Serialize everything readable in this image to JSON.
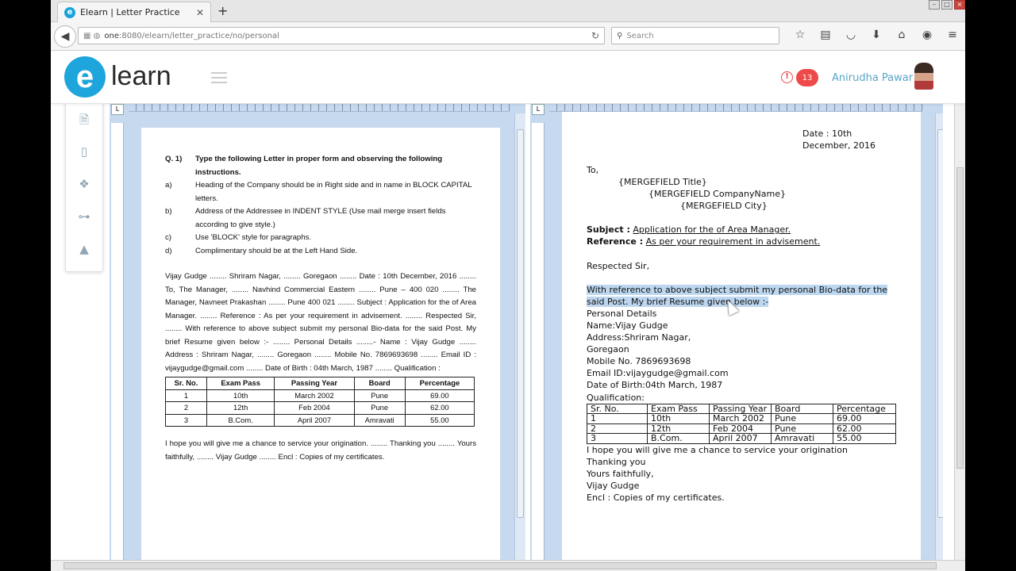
{
  "browser": {
    "tab_title": "Elearn | Letter Practice",
    "tab_favicon": "e",
    "url_host": "one",
    "url_path": ":8080/elearn/letter_practice/no/personal",
    "search_placeholder": "Search",
    "new_tab_label": "+",
    "close_label": "✕"
  },
  "app": {
    "logo_mark": "e",
    "logo_text": "learn",
    "notification_count": "13",
    "alert_glyph": "!",
    "user_name": "Anirudha Pawar",
    "brand_color": "#1ea5dc",
    "badge_color": "#ee4a4a"
  },
  "sidebar_icons": [
    "document-icon",
    "file-icon",
    "dropbox-icon",
    "gamepad-icon",
    "graduation-cap-icon"
  ],
  "left_page": {
    "q_num": "Q. 1)",
    "q_title": "Type the following Letter in proper form and observing the following instructions.",
    "instructions": [
      {
        "marker": "a)",
        "text": "Heading of the Company should be in Right side and in name in BLOCK CAPITAL letters."
      },
      {
        "marker": "b)",
        "text": "Address of the Addressee in INDENT STYLE (Use mail merge insert fields according to give style.)"
      },
      {
        "marker": "c)",
        "text": "Use 'BLOCK' style for paragraphs."
      },
      {
        "marker": "d)",
        "text": "Complimentary should be at the Left Hand Side."
      }
    ],
    "body": "Vijay Gudge ........ Shriram Nagar, ........ Goregaon ........ Date : 10th December, 2016 ........ To, The Manager, ........ Navhind Commercial Eastern ........ Pune – 400 020 ........ The Manager, Navneet Prakashan ........ Pune 400 021 ........ Subject : Application for the of Area Manager. ........ Reference : As per your requirement in advisement. ........ Respected Sir, ........ With reference to above subject submit my personal Bio-data for the said Post. My brief Resume given below :- ........ Personal Details ........- Name : Vijay Gudge ........ Address : Shriram Nagar, ........ Goregaon ........ Mobile No. 7869693698 ........ Email ID : vijaygudge@gmail.com ........ Date of Birth : 04th March, 1987 ........ Qualification :",
    "table_headers": [
      "Sr. No.",
      "Exam Pass",
      "Passing Year",
      "Board",
      "Percentage"
    ],
    "table_rows": [
      [
        "1",
        "10th",
        "March 2002",
        "Pune",
        "69.00"
      ],
      [
        "2",
        "12th",
        "Feb 2004",
        "Pune",
        "62.00"
      ],
      [
        "3",
        "B.Com.",
        "April 2007",
        "Amravati",
        "55.00"
      ]
    ],
    "closing": "I hope you will give me a chance to service your origination. ........ Thanking you ........ Yours faithfully, ........ Vijay Gudge ........ Encl : Copies of my certificates."
  },
  "right_page": {
    "date_line1": "Date : 10th",
    "date_line2": "December, 2016",
    "to": "To,",
    "merge1": "{MERGEFIELD Title}",
    "merge2": "{MERGEFIELD CompanyName}",
    "merge3": "{MERGEFIELD City}",
    "subject_label": "Subject :",
    "subject_text": "Application for the of Area Manager.",
    "reference_label": "Reference :",
    "reference_text": "As per your requirement in advisement.",
    "salutation": "Respected Sir,",
    "selected_text": "With reference to above subject submit my personal Bio-data for the said Post. My brief Resume given below :-",
    "details": [
      "Personal Details",
      "Name:Vijay Gudge",
      "Address:Shriram Nagar,",
      "Goregaon",
      "Mobile No. 7869693698",
      "Email ID:vijaygudge@gmail.com",
      "Date of Birth:04th March, 1987",
      "Qualification:"
    ],
    "table_headers": [
      "Sr. No.",
      "Exam Pass",
      "Passing Year",
      "Board",
      "Percentage"
    ],
    "table_rows": [
      [
        "1",
        "10th",
        "March 2002",
        "Pune",
        "69.00"
      ],
      [
        "2",
        "12th",
        "Feb 2004",
        "Pune",
        "62.00"
      ],
      [
        "3",
        "B.Com.",
        "April 2007",
        "Amravati",
        "55.00"
      ]
    ],
    "closing": [
      "I hope you will give me a chance to service your origination",
      "Thanking you",
      "Yours faithfully,",
      "Vijay Gudge",
      "Encl : Copies of my certificates."
    ]
  }
}
